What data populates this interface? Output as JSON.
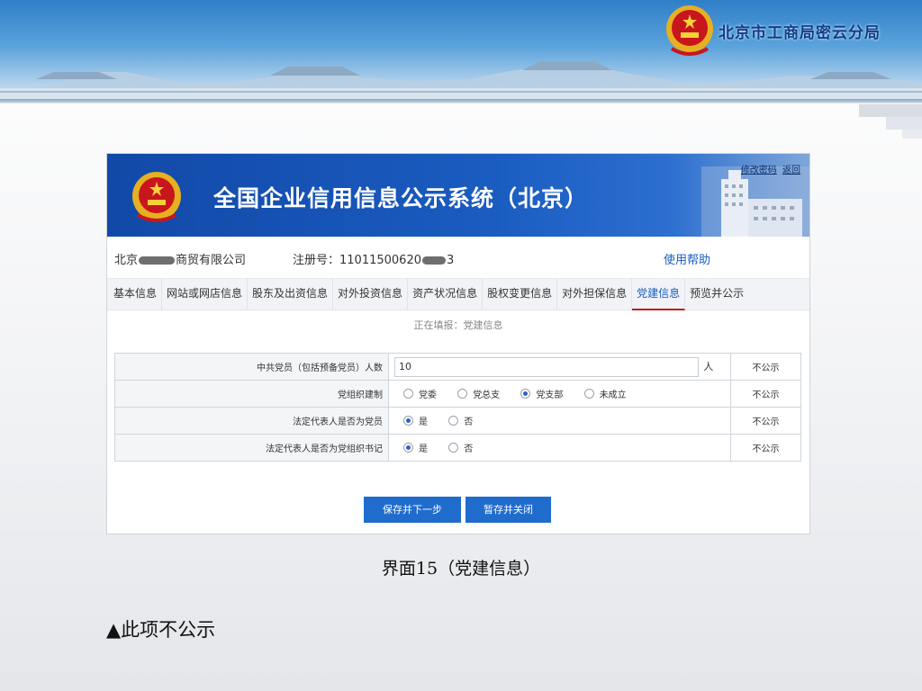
{
  "slide": {
    "org_name": "北京市工商局密云分局",
    "caption": "界面15（党建信息）",
    "note": "▲此项不公示"
  },
  "system": {
    "title": "全国企业信用信息公示系统（北京）",
    "top_links": {
      "change_password": "修改密码",
      "back": "返回"
    }
  },
  "company": {
    "name_prefix": "北京",
    "name_suffix": "商贸有限公司",
    "reg_label": "注册号：",
    "reg_prefix": "11011500620",
    "reg_suffix": "3",
    "help": "使用帮助"
  },
  "tabs": [
    {
      "label": "基本信息"
    },
    {
      "label": "网站或网店信息"
    },
    {
      "label": "股东及出资信息"
    },
    {
      "label": "对外投资信息"
    },
    {
      "label": "资产状况信息"
    },
    {
      "label": "股权变更信息"
    },
    {
      "label": "对外担保信息"
    },
    {
      "label": "党建信息",
      "active": true
    },
    {
      "label": "预览并公示"
    }
  ],
  "form": {
    "status": "正在填报：党建信息",
    "rows": [
      {
        "label": "中共党员（包括预备党员）人数",
        "value": "10",
        "unit": "人",
        "publicity": "不公示"
      },
      {
        "label": "党组织建制",
        "options": [
          "党委",
          "党总支",
          "党支部",
          "未成立"
        ],
        "selected": "党支部",
        "publicity": "不公示"
      },
      {
        "label": "法定代表人是否为党员",
        "options": [
          "是",
          "否"
        ],
        "selected": "是",
        "publicity": "不公示"
      },
      {
        "label": "法定代表人是否为党组织书记",
        "options": [
          "是",
          "否"
        ],
        "selected": "是",
        "publicity": "不公示"
      }
    ],
    "buttons": {
      "save_next": "保存并下一步",
      "save_close": "暂存并关闭"
    }
  },
  "colors": {
    "banner_blue": "#2f7fc8",
    "header_blue": "#1a5cc0",
    "button_blue": "#1f6ccd",
    "active_tab_underline": "#c21d1d"
  },
  "icons": [
    "national-emblem-icon",
    "building-icon",
    "radio-icon"
  ]
}
